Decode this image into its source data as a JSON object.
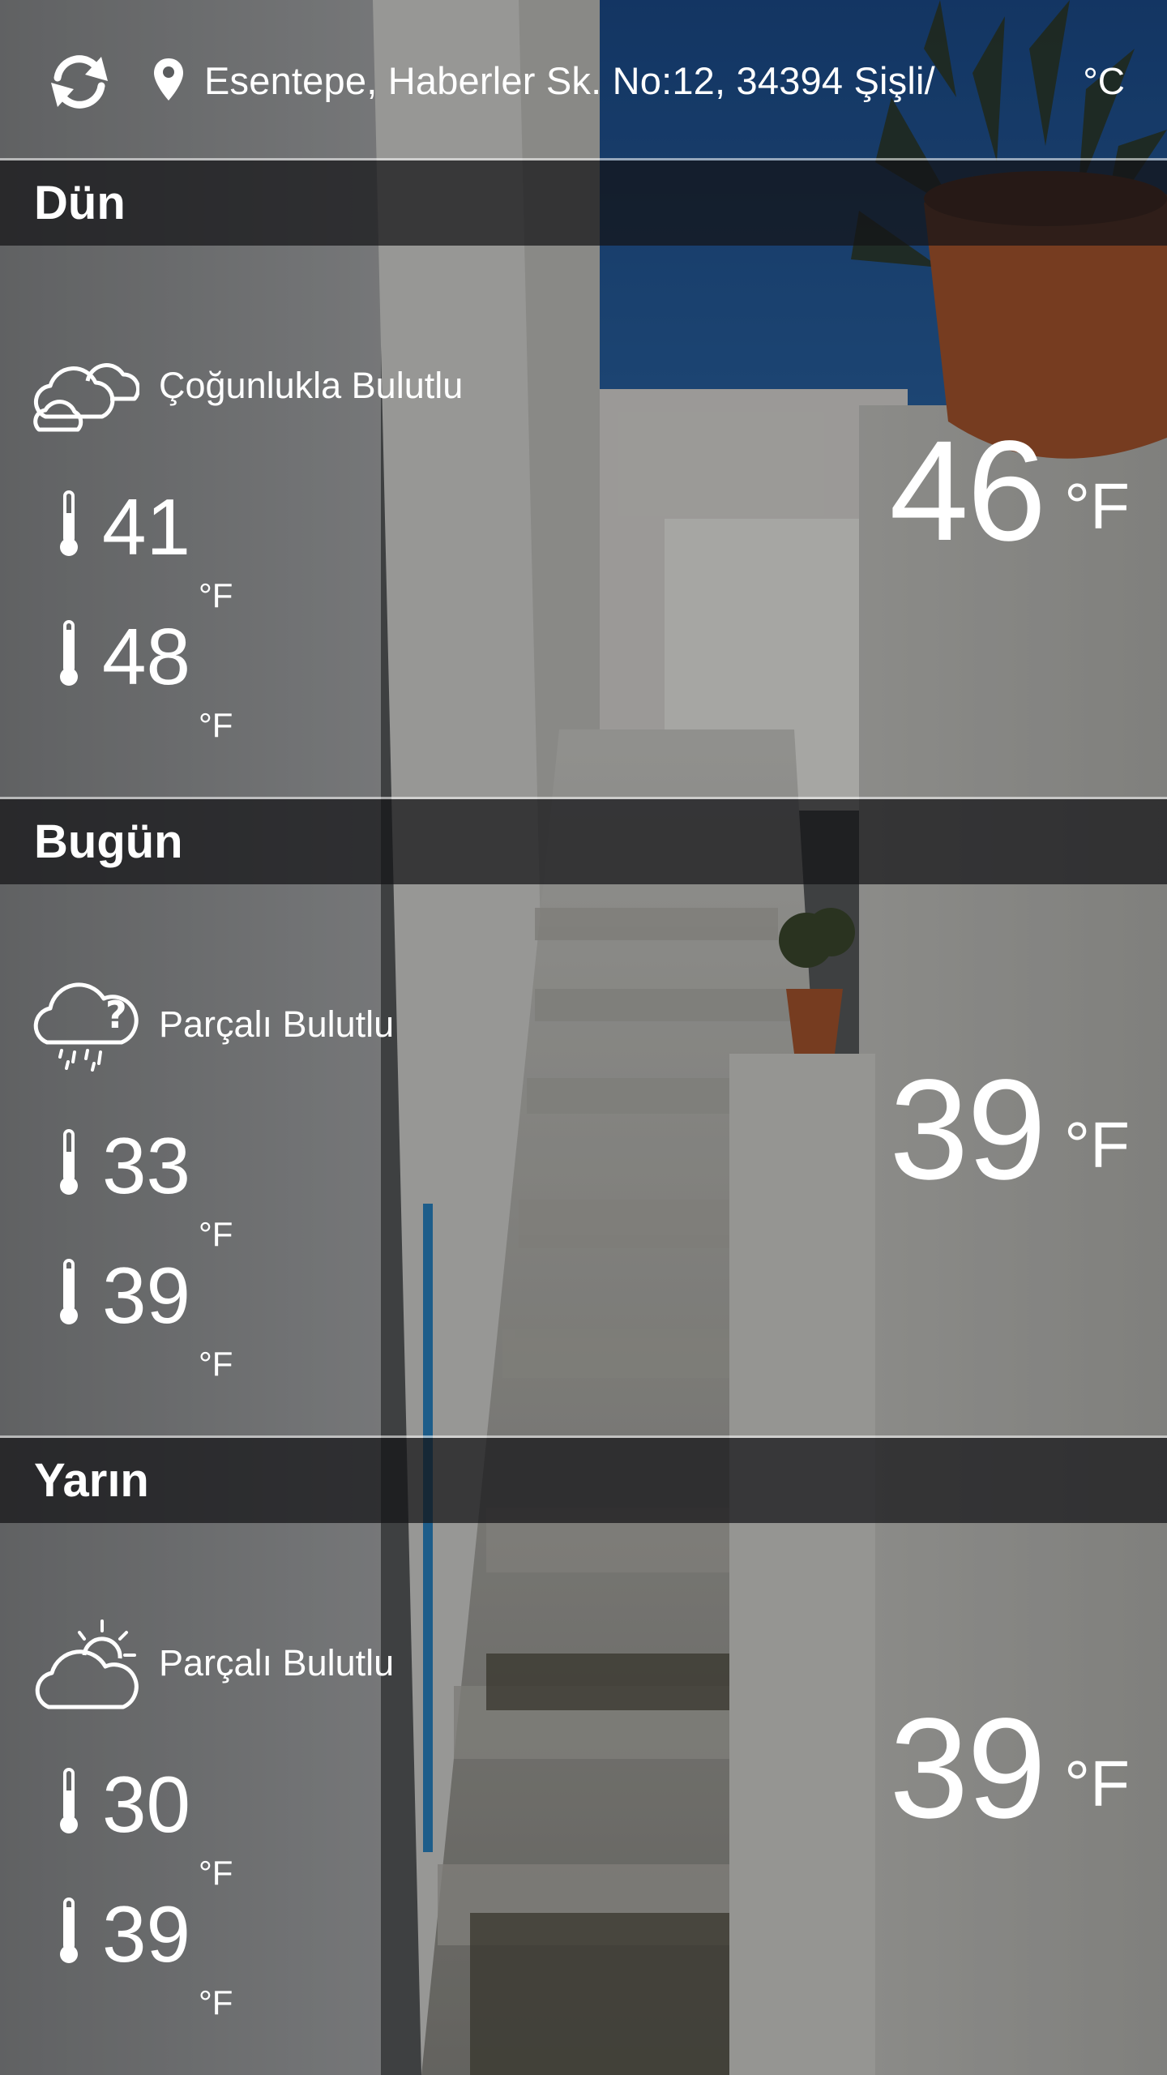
{
  "header": {
    "location": "Esentepe, Haberler Sk. No:12, 34394 Şişli/",
    "unit_toggle": "°C"
  },
  "days": [
    {
      "title": "Dün",
      "condition": "Çoğunlukla Bulutlu",
      "icon": "mostly-cloudy-icon",
      "low": "41",
      "high": "48",
      "current": "46",
      "unit": "°F"
    },
    {
      "title": "Bugün",
      "condition": "Parçalı Bulutlu",
      "icon": "cloud-question-rain-icon",
      "low": "33",
      "high": "39",
      "current": "39",
      "unit": "°F"
    },
    {
      "title": "Yarın",
      "condition": "Parçalı Bulutlu",
      "icon": "partly-cloudy-sun-icon",
      "low": "30",
      "high": "39",
      "current": "39",
      "unit": "°F"
    }
  ],
  "colors": {
    "header_band": "#1a1a1c",
    "text": "#ffffff",
    "sky": "#1f4f86",
    "pot": "#a9562f"
  }
}
